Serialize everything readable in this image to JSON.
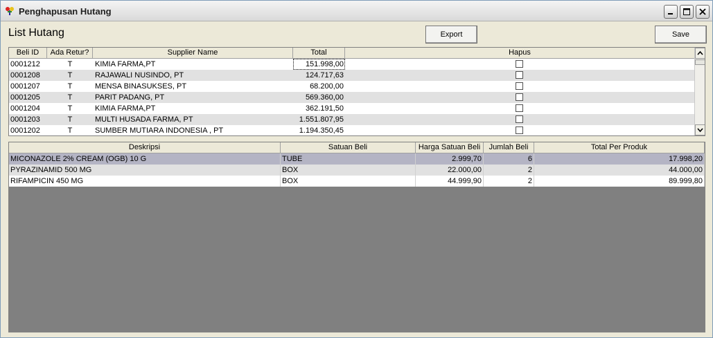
{
  "window": {
    "title": "Penghapusan Hutang"
  },
  "header": {
    "list_title": "List Hutang",
    "export_label": "Export",
    "save_label": "Save"
  },
  "top_grid": {
    "columns": [
      "Beli ID",
      "Ada Retur?",
      "Supplier Name",
      "Total",
      "Hapus"
    ],
    "rows": [
      {
        "id": "0001212",
        "retur": "T",
        "supplier": "KIMIA FARMA,PT",
        "total": "151.998,00",
        "hapus": false
      },
      {
        "id": "0001208",
        "retur": "T",
        "supplier": "RAJAWALI NUSINDO, PT",
        "total": "124.717,63",
        "hapus": false
      },
      {
        "id": "0001207",
        "retur": "T",
        "supplier": "MENSA BINASUKSES, PT",
        "total": "68.200,00",
        "hapus": false
      },
      {
        "id": "0001205",
        "retur": "T",
        "supplier": "PARIT PADANG, PT",
        "total": "569.360,00",
        "hapus": false
      },
      {
        "id": "0001204",
        "retur": "T",
        "supplier": "KIMIA FARMA,PT",
        "total": "362.191,50",
        "hapus": false
      },
      {
        "id": "0001203",
        "retur": "T",
        "supplier": "MULTI HUSADA FARMA, PT",
        "total": "1.551.807,95",
        "hapus": false
      },
      {
        "id": "0001202",
        "retur": "T",
        "supplier": "SUMBER MUTIARA INDONESIA , PT",
        "total": "1.194.350,45",
        "hapus": false
      }
    ]
  },
  "bottom_grid": {
    "columns": [
      "Deskripsi",
      "Satuan Beli",
      "Harga Satuan Beli",
      "Jumlah Beli",
      "Total Per Produk"
    ],
    "rows": [
      {
        "desc": "MICONAZOLE 2% CREAM (OGB) 10 G",
        "satuan": "TUBE",
        "harga": "2.999,70",
        "jumlah": "6",
        "total": "17.998,20"
      },
      {
        "desc": "PYRAZINAMID 500 MG",
        "satuan": "BOX",
        "harga": "22.000,00",
        "jumlah": "2",
        "total": "44.000,00"
      },
      {
        "desc": "RIFAMPICIN 450 MG",
        "satuan": "BOX",
        "harga": "44.999,90",
        "jumlah": "2",
        "total": "89.999,80"
      }
    ]
  },
  "colors": {
    "selected_row": "#b4b4c4",
    "alt_row": "#e1e1e1",
    "empty_area": "#808080"
  }
}
